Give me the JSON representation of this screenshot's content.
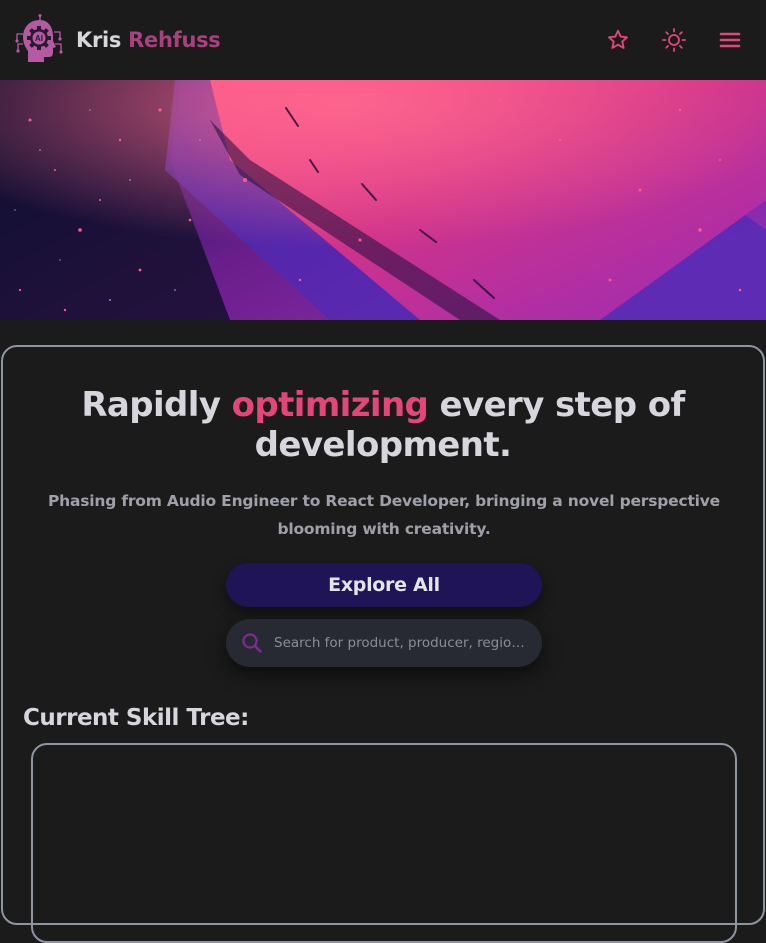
{
  "header": {
    "brand_first": "Kris",
    "brand_last": "Rehfuss",
    "logo_text": "AI",
    "logo_icon": "ai-head-logo",
    "actions": [
      {
        "name": "favorites",
        "icon": "star-icon"
      },
      {
        "name": "theme",
        "icon": "sun-icon"
      },
      {
        "name": "menu",
        "icon": "hamburger-icon"
      }
    ]
  },
  "colors": {
    "background": "#1b1b1c",
    "accent_pink": "#e4467a",
    "brand_magenta": "#a8417d",
    "button_purple": "#1f1456",
    "search_bg": "#272a33",
    "border": "#8e94a0"
  },
  "hero": {
    "headline_before": "Rapidly ",
    "headline_accent": "optimizing",
    "headline_after": " every step of development.",
    "subline": "Phasing from Audio Engineer to React Developer, bringing a novel perspective blooming with creativity.",
    "explore_label": "Explore All",
    "search_placeholder": "Search for product, producer, region..."
  },
  "skills": {
    "title": "Current Skill Tree:"
  }
}
